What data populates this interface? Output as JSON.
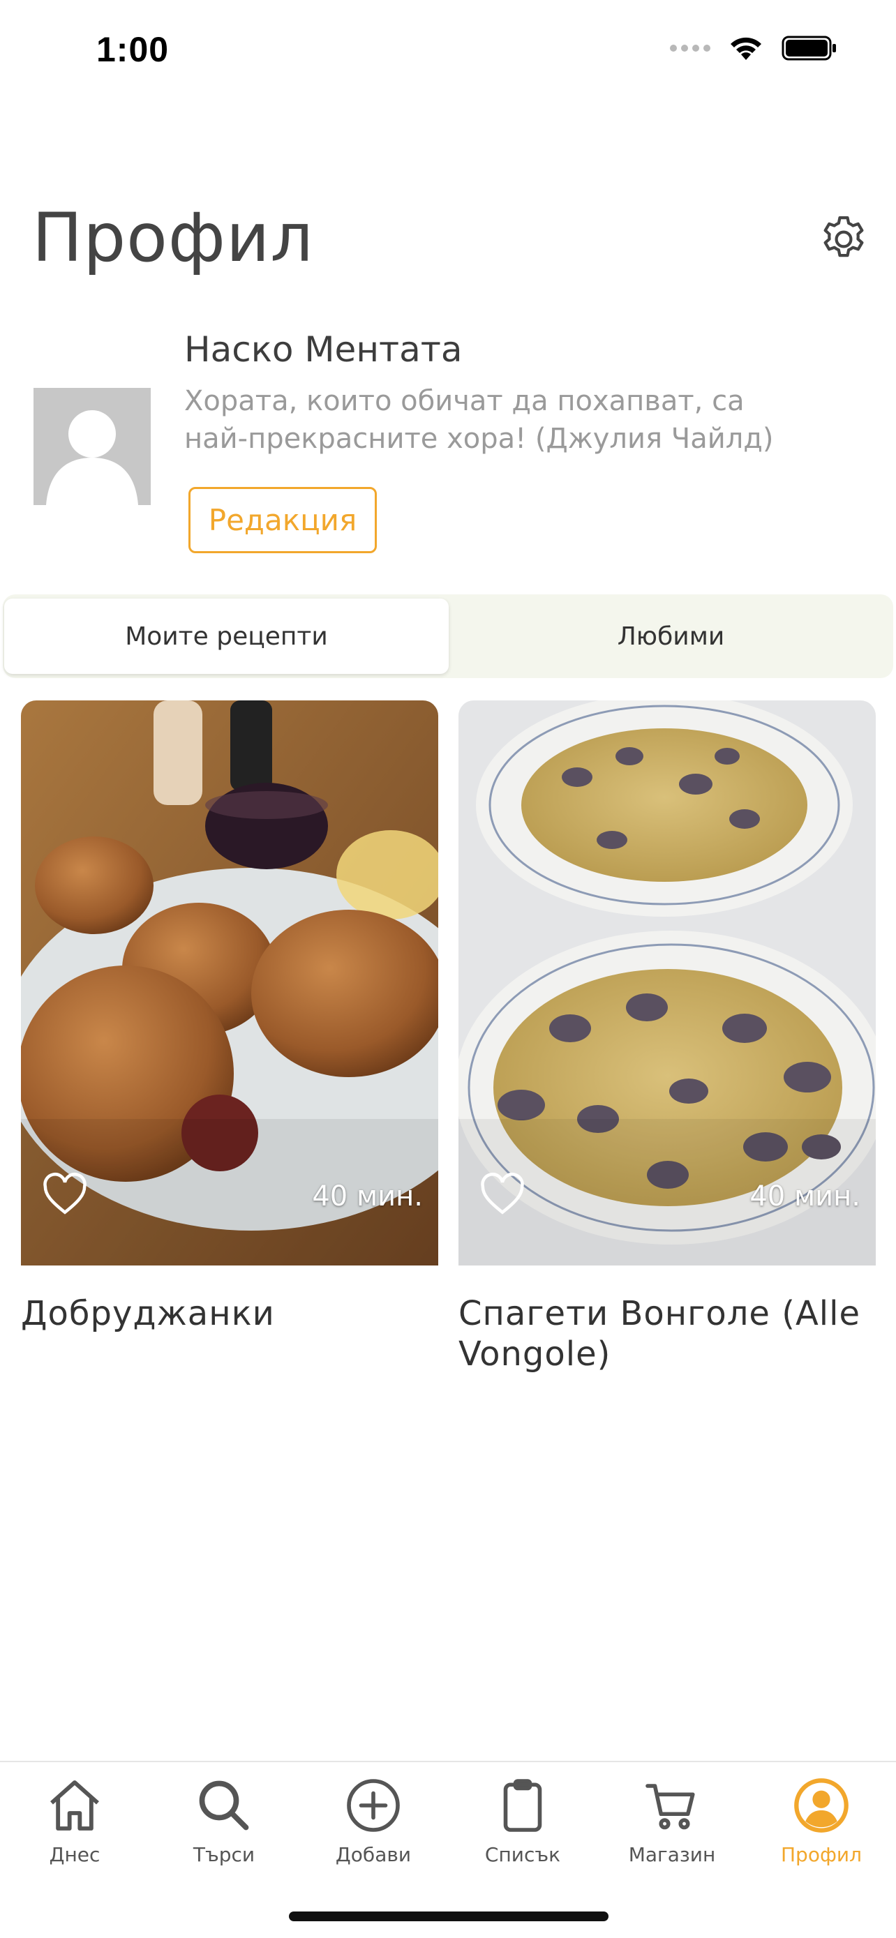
{
  "status_bar": {
    "time": "1:00"
  },
  "header": {
    "title": "Профил",
    "settings_icon": "gear-icon"
  },
  "profile": {
    "name": "Наско Ментата",
    "quote": "Хората, които обичат да похапват, са най-прекрасните хора! (Джулия Чайлд)",
    "edit_label": "Редакция"
  },
  "tabs": [
    {
      "label": "Моите рецепти",
      "active": true
    },
    {
      "label": "Любими",
      "active": false
    }
  ],
  "recipes": [
    {
      "title": "Добруджанки",
      "duration": "40 мин.",
      "favorite": false
    },
    {
      "title": "Спагети Вонголе (Alle Vongole)",
      "duration": "40 мин.",
      "favorite": false
    }
  ],
  "tabbar": [
    {
      "label": "Днес",
      "icon": "home-icon"
    },
    {
      "label": "Търси",
      "icon": "search-icon"
    },
    {
      "label": "Добави",
      "icon": "plus-circle-icon"
    },
    {
      "label": "Списък",
      "icon": "clipboard-icon"
    },
    {
      "label": "Магазин",
      "icon": "cart-icon"
    },
    {
      "label": "Профил",
      "icon": "user-circle-icon",
      "active": true
    }
  ],
  "colors": {
    "accent": "#f2a72c",
    "tabs_bg": "#f4f6ed",
    "text": "#333333",
    "muted": "#9a9a9a"
  }
}
